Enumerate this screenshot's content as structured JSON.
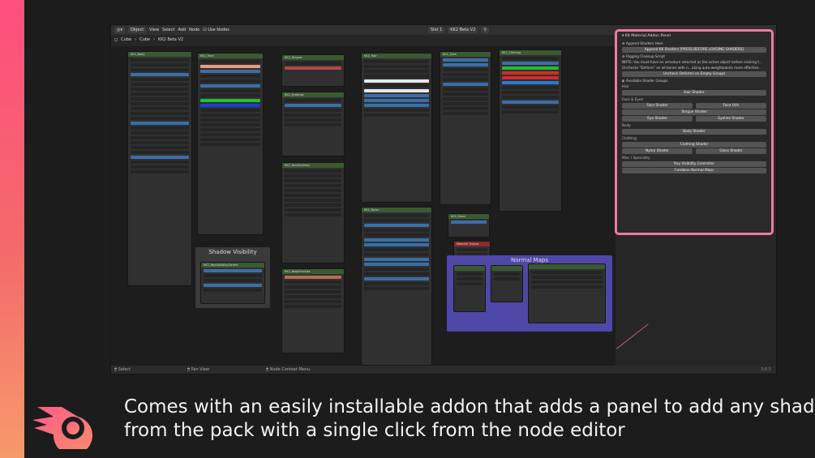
{
  "header": {
    "object_mode": "Object",
    "menus": [
      "View",
      "Select",
      "Add",
      "Node"
    ],
    "use_nodes": "Use Nodes",
    "slot": "Slot 1",
    "material": "KK2 Beta V2"
  },
  "breadcrumb": [
    "Cube",
    "Cube",
    "KK2 Beta V2"
  ],
  "nodes": {
    "body": "KK2_Body",
    "face": "KK2_Face",
    "tongue": "KK2_Tongue",
    "eyebrow": "KK2_Eyebrow",
    "hair": "KK2_Hair",
    "eyes": "KK2_Eyes",
    "clothing": "KK2_Clothing",
    "face_outlines": "KK2_FaceOutlines",
    "nylon": "KK2_Nylon",
    "glass": "KK2_Glass",
    "body_freckles": "KK2_BodyFreckles",
    "rayvis": "KK2_RayVisibilityControl",
    "material_output": "Material Output"
  },
  "frames": {
    "shadow_visibility": "Shadow Visibility",
    "normal_maps": "Normal Maps"
  },
  "panel": {
    "title": "KK Material Addon Panel",
    "append_shaders_here": "Append Shaders Here",
    "append_button": "Append KK Shaders [PRESS BEFORE LOADING SHADERS]",
    "rigging_cleanup": "Rigging Cleanup Script",
    "note1": "NOTE: You must have an armature selected as the active object before clicking t…",
    "note2": "Unchecks \"Deform\" on all bones with n…aking auto-weightpaints more effective.",
    "uncheck_button": "Uncheck Deforms on Empty Groups",
    "available_groups": "Available Shader Groups",
    "hair_label": "Hair",
    "hair_shader": "Hair Shader",
    "face_eyes_label": "Face & Eyes",
    "face_shader": "Face Shader",
    "face_uvs": "Face UVs",
    "tongue_shader": "Tongue Shader",
    "eye_shader": "Eye Shader",
    "eyeline_shader": "Eyeline Shader",
    "body_label": "Body",
    "body_shader": "Body Shader",
    "clothing_label": "Clothing",
    "clothing_shader": "Clothing Shader",
    "nylon_shader": "Nylon Shader",
    "glass_shader": "Glass Shader",
    "misc_label": "Misc / Speciality",
    "ray_visibility": "Ray Visibility Controller",
    "combine_normal": "Combine Normal Maps"
  },
  "statusbar": {
    "select": "Select",
    "pan": "Pan View",
    "context": "Node Context Menu",
    "version": "3.6.5"
  },
  "caption": {
    "line1": "Comes with an easily installable addon that adds a panel to add any shader",
    "line2": "from the pack with a single click from the node editor"
  },
  "colors": {
    "accent_pink": "#f07aa0",
    "node_header_green": "#3a5a32",
    "frame_purple": "#5048a8"
  }
}
